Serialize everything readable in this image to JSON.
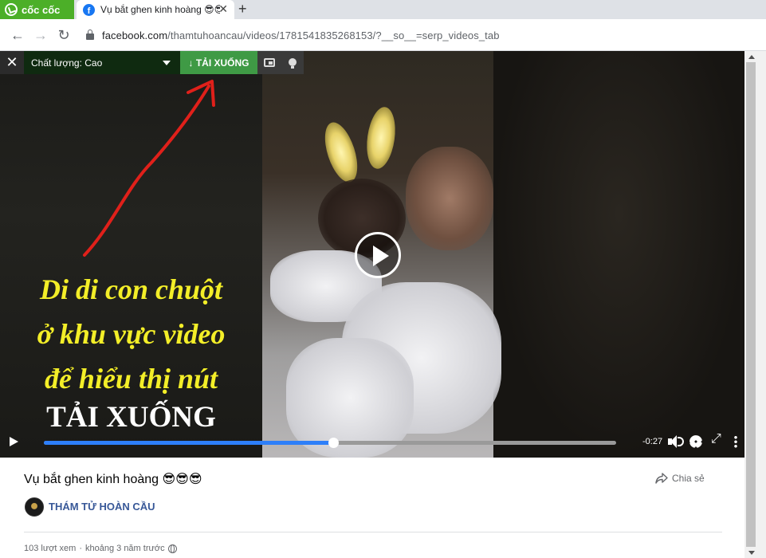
{
  "browser": {
    "brand_label": "cốc cốc",
    "tab_title": "Vụ bắt ghen kinh hoàng 😎😎",
    "url_host": "facebook.com",
    "url_path": "/thamtuhoancau/videos/1781541835268153/?__so__=serp_videos_tab"
  },
  "player": {
    "quality_label": "Chất lượng: Cao",
    "download_label": "↓ TẢI XUỐNG",
    "caption_lines": [
      "Di di con chuột",
      "ở khu vực video",
      "để hiểu thị nút"
    ],
    "caption_emphasis": "TẢI XUỐNG",
    "time_remaining": "-0:27",
    "progress": 0.505,
    "colors": {
      "download": "#3f9a45",
      "progress": "#2d7ff9",
      "caption": "#f3ee28",
      "arrow": "#e0201a"
    }
  },
  "post": {
    "title": "Vụ bắt ghen kinh hoàng 😎😎😎",
    "share_label": "Chia sẻ",
    "page_name": "THÁM TỬ HOÀN CẦU",
    "views": "103 lượt xem",
    "separator": "·",
    "time_ago": "khoảng 3 năm trước",
    "privacy_icon": "globe-icon"
  }
}
